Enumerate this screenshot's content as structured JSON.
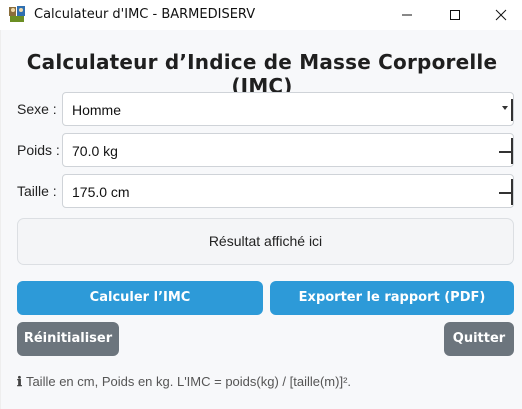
{
  "window": {
    "title": "Calculateur d'IMC - BARMEDISERV",
    "icon": "app-icon"
  },
  "heading": "Calculateur d’Indice de Masse Corporelle (IMC)",
  "form": {
    "sexe_label": "Sexe :",
    "sexe_value": "Homme",
    "poids_label": "Poids :",
    "poids_value": "70.0 kg",
    "taille_label": "Taille :",
    "taille_value": "175.0 cm"
  },
  "result_text": "Résultat affiché ici",
  "buttons": {
    "calculate": "Calculer l’IMC",
    "export": "Exporter le rapport (PDF)",
    "reset": "Réinitialiser",
    "quit": "Quitter"
  },
  "hint": {
    "icon": "info-icon",
    "text": "Taille en cm, Poids en kg. L'IMC = poids(kg) / [taille(m)]²."
  },
  "colors": {
    "primary": "#2d9ad8",
    "secondary": "#6c757d",
    "background": "#f7f8fa"
  }
}
